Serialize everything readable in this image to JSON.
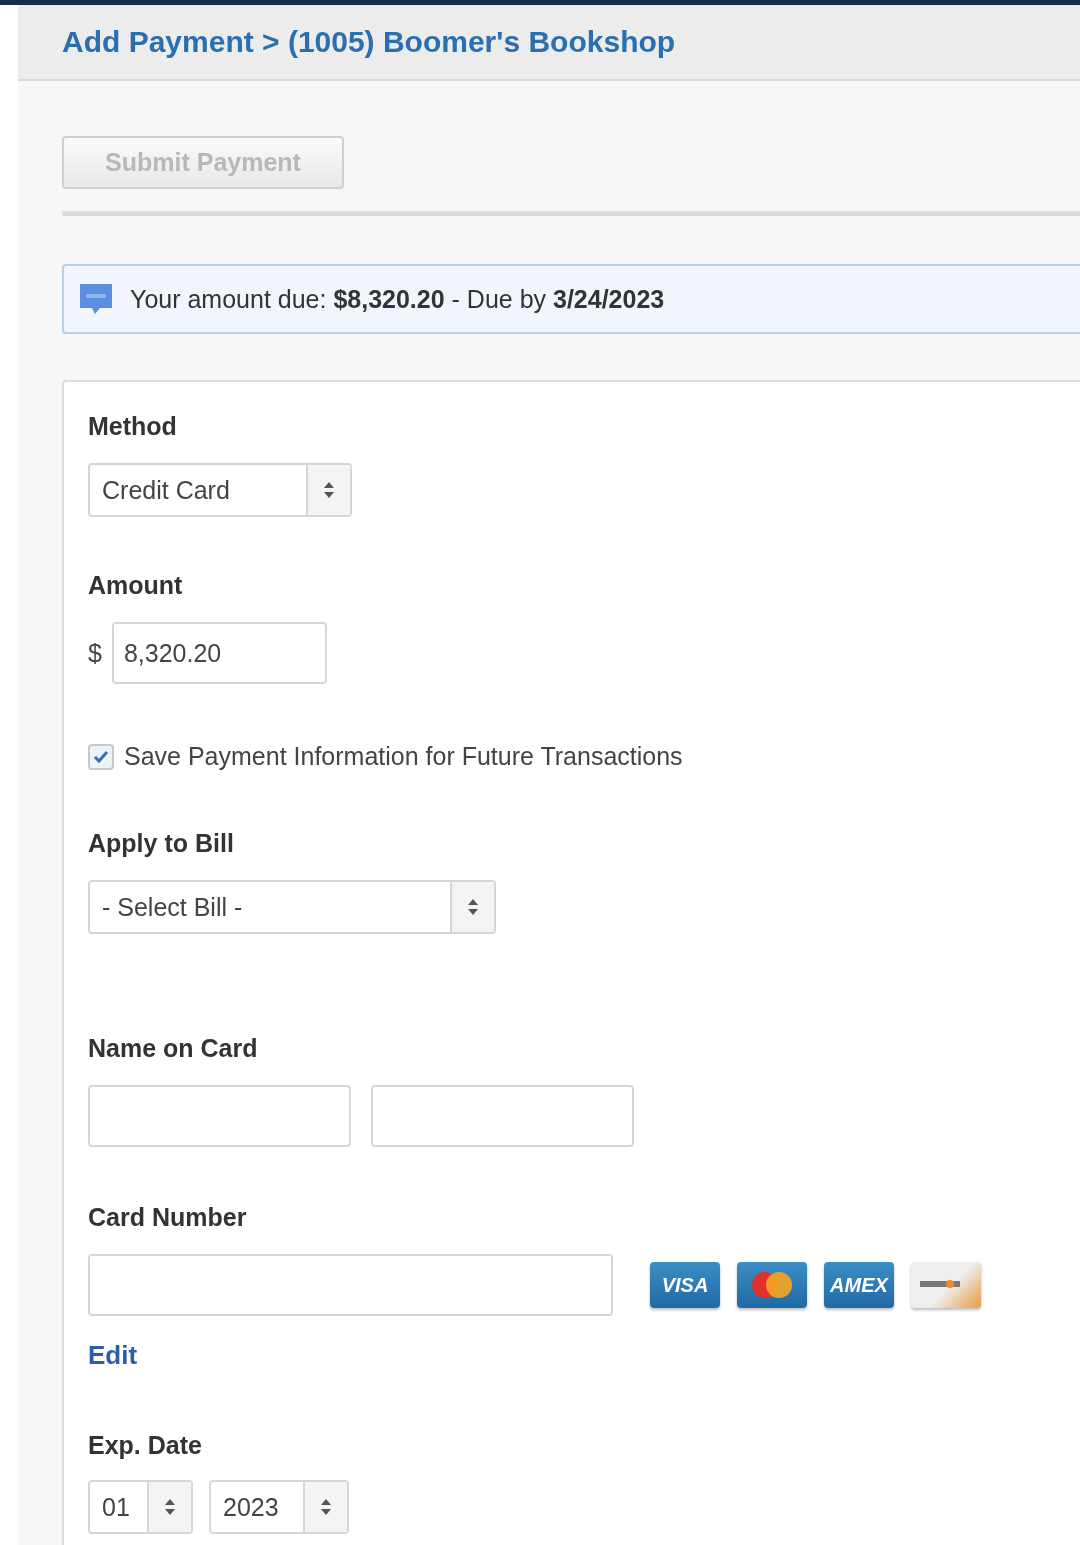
{
  "breadcrumb": {
    "title": "Add Payment > (1005) Boomer's Bookshop"
  },
  "submit_button": {
    "label": "Submit Payment",
    "disabled": true
  },
  "notice": {
    "text": "Your amount due: **$8,320.20** - Due by **3/24/2023**"
  },
  "form": {
    "method": {
      "label": "Method",
      "value": "Credit Card"
    },
    "amount": {
      "label": "Amount",
      "currency": "$",
      "value": "8,320.20"
    },
    "save_info": {
      "label": "Save Payment Information for Future Transactions",
      "checked": true
    },
    "apply_to_bill": {
      "label": "Apply to Bill",
      "value": "- Select Bill -"
    },
    "name_on_card": {
      "label": "Name on Card"
    },
    "card_number": {
      "label": "Card Number",
      "edit_link": "Edit",
      "cards": [
        {
          "kind": "visa",
          "label": "VISA"
        },
        {
          "kind": "mastercard"
        },
        {
          "kind": "amex",
          "label": "AMEX"
        },
        {
          "kind": "discover"
        }
      ]
    },
    "exp_date": {
      "label": "Exp. Date",
      "month": "01",
      "year": "2023"
    }
  }
}
